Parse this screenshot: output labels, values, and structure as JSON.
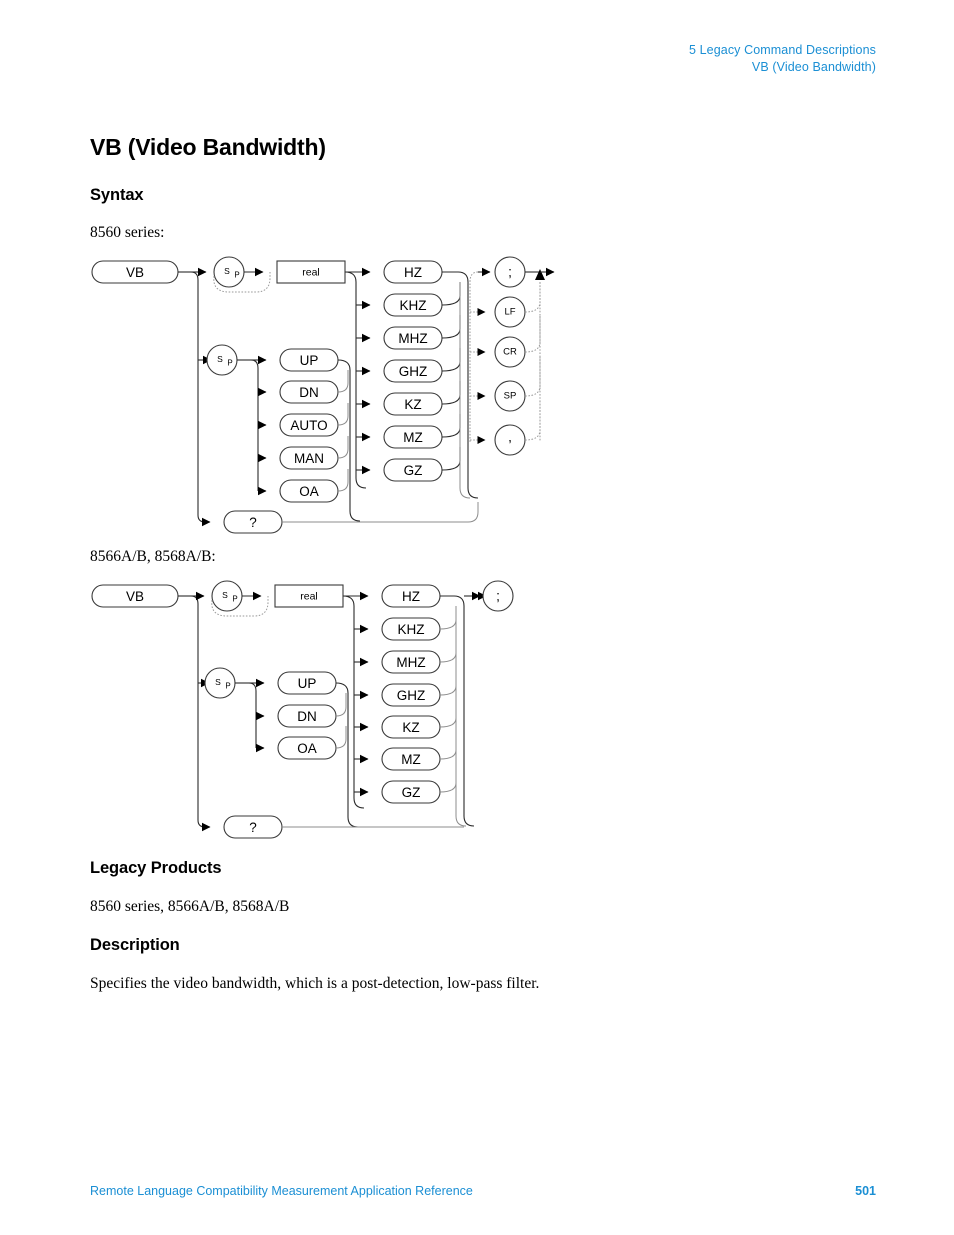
{
  "header": {
    "chapter": "5  Legacy Command Descriptions",
    "topic": "VB (Video Bandwidth)"
  },
  "title": "VB (Video Bandwidth)",
  "sections": {
    "syntax_heading": "Syntax",
    "syntax_label_1": "8560 series:",
    "syntax_label_2": "8566A/B, 8568A/B:",
    "legacy_heading": "Legacy Products",
    "legacy_products": "8560 series, 8566A/B, 8568A/B",
    "description_heading": "Description",
    "description_text": "Specifies the video bandwidth, which is a post-detection, low-pass filter."
  },
  "footer": {
    "text": "Remote Language Compatibility Measurement Application Reference",
    "page": "501"
  },
  "colors": {
    "accent_blue": "#1b8fd4",
    "line": "#2b2b2b",
    "dotted": "#9a9a9a"
  },
  "diagrams": [
    {
      "id": "syntax-diagram-8560",
      "caption": "8560 series:",
      "command": "VB",
      "separator": "Sp",
      "value_node": "real",
      "keywords": [
        "UP",
        "DN",
        "AUTO",
        "MAN",
        "OA"
      ],
      "query": "?",
      "units": [
        "HZ",
        "KHZ",
        "MHZ",
        "GHZ",
        "KZ",
        "MZ",
        "GZ"
      ],
      "terminators": [
        ";",
        "LF",
        "CR",
        "SP",
        ","
      ]
    },
    {
      "id": "syntax-diagram-8566-8568",
      "caption": "8566A/B, 8568A/B:",
      "command": "VB",
      "separator": "Sp",
      "value_node": "real",
      "keywords": [
        "UP",
        "DN",
        "OA"
      ],
      "query": "?",
      "units": [
        "HZ",
        "KHZ",
        "MHZ",
        "GHZ",
        "KZ",
        "MZ",
        "GZ"
      ],
      "terminators": [
        ";"
      ]
    }
  ]
}
